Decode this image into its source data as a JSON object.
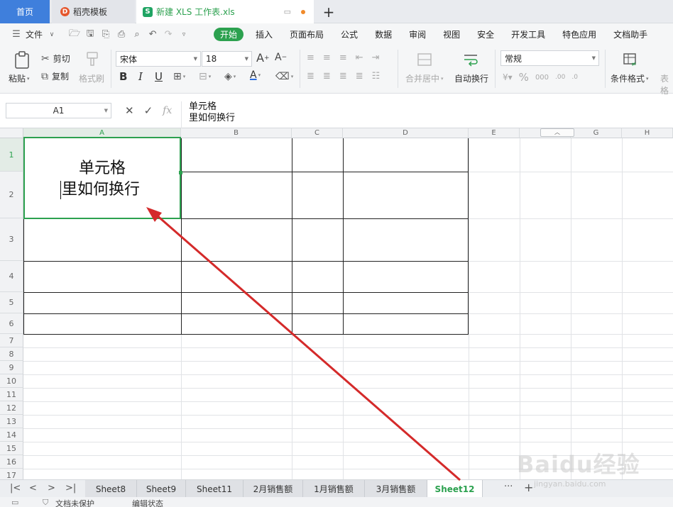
{
  "titlebar": {
    "home_tab": "首页",
    "template_tab": "稻壳模板",
    "file_tab": "新建 XLS 工作表.xls",
    "new_tab_symbol": "+"
  },
  "menubar": {
    "file_menu": "文件",
    "tabs": [
      "开始",
      "插入",
      "页面布局",
      "公式",
      "数据",
      "审阅",
      "视图",
      "安全",
      "开发工具",
      "特色应用",
      "文档助手"
    ],
    "active_tab": "开始"
  },
  "ribbon": {
    "paste": "粘贴",
    "cut": "剪切",
    "copy": "复制",
    "format_painter": "格式刷",
    "font_name": "宋体",
    "font_size": "18",
    "merge_center": "合并居中",
    "auto_wrap": "自动换行",
    "number_format": "常规",
    "conditional_format": "条件格式",
    "table_style": "表格"
  },
  "formula_bar": {
    "name_box": "A1",
    "fx_label": "fx",
    "content_line1": "单元格",
    "content_line2": "里如何换行"
  },
  "grid": {
    "columns": [
      "A",
      "B",
      "C",
      "D",
      "E",
      "F",
      "G",
      "H"
    ],
    "rows": [
      "1",
      "2",
      "3",
      "4",
      "5",
      "6",
      "7",
      "8",
      "9",
      "10",
      "11",
      "12",
      "13",
      "14",
      "15",
      "16",
      "17"
    ],
    "selected_cell": "A1",
    "cell_a1_line1": "单元格",
    "cell_a1_line2": "里如何换行"
  },
  "sheet_tabs": {
    "tabs": [
      "Sheet8",
      "Sheet9",
      "Sheet11",
      "2月销售额",
      "1月销售额",
      "3月销售额",
      "Sheet12"
    ],
    "active": "Sheet12",
    "more": "···",
    "add": "+"
  },
  "statusbar": {
    "doc_protect": "文档未保护",
    "edit_state": "编辑状态"
  },
  "watermark": {
    "text": "Baidu经验",
    "sub": "jingyan.baidu.com"
  },
  "colors": {
    "accent_green": "#2ca14f",
    "home_blue": "#3f7fdc",
    "arrow_red": "#d42a2a"
  }
}
